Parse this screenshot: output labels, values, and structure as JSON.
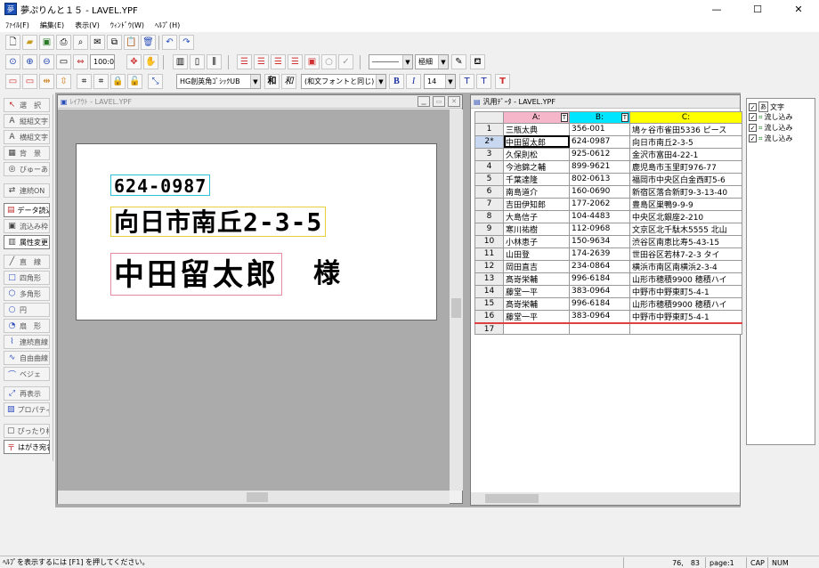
{
  "app": {
    "title": "夢ぷりんと１５ - LAVEL.YPF",
    "logo_glyph": "夢",
    "win_minimize": "—",
    "win_maximize": "☐",
    "win_close": "✕"
  },
  "menu": [
    "ﾌｧｲﾙ(F)",
    "編集(E)",
    "表示(V)",
    "ｳｨﾝﾄﾞｳ(W)",
    "ﾍﾙﾌﾟ(H)"
  ],
  "toolbar": {
    "zoom_value": "100:0",
    "line_style_value": "",
    "line_weight_value": "極細",
    "font_name_value": "HG創英角ｺﾞｼｯｸUB",
    "font_kanji_glyph": "和",
    "font_kanji_italic_glyph": "和",
    "western_font_value": "(和文フォントと同じ)",
    "bold_glyph": "B",
    "italic_glyph": "I",
    "font_size_value": "14"
  },
  "left_tools": [
    {
      "label": "選　択",
      "icon": "↖"
    },
    {
      "label": "縦組文字",
      "icon": "A"
    },
    {
      "label": "横組文字",
      "icon": "A"
    },
    {
      "label": "背　景",
      "icon": "▦"
    },
    {
      "label": "びゅーあ",
      "icon": "◎"
    },
    {
      "label": "連続ON",
      "icon": "⇄"
    },
    {
      "label": "データ読込",
      "icon": "▤"
    },
    {
      "label": "流込み枠",
      "icon": "▣"
    },
    {
      "label": "属性変更",
      "icon": "▥"
    },
    {
      "label": "直　線",
      "icon": "╱"
    },
    {
      "label": "四角形",
      "icon": "□"
    },
    {
      "label": "多角形",
      "icon": "⬡"
    },
    {
      "label": "円",
      "icon": "○"
    },
    {
      "label": "扇　形",
      "icon": "◔"
    },
    {
      "label": "連続直線",
      "icon": "⌇"
    },
    {
      "label": "自由曲線",
      "icon": "∿"
    },
    {
      "label": "ベジェ",
      "icon": "⌒"
    },
    {
      "label": "再表示",
      "icon": "⤢"
    },
    {
      "label": "プロパティ",
      "icon": "▧"
    },
    {
      "label": "ぴったり枠",
      "icon": "▢"
    },
    {
      "label": "はがき宛名",
      "icon": "〒"
    }
  ],
  "layout_window": {
    "title": "ﾚｲｱｳﾄ - LAVEL.YPF",
    "postal": "624-0987",
    "address": "向日市南丘2-3-5",
    "name": "中田留太郎",
    "honorific": "様"
  },
  "data_window": {
    "title": "汎用ﾃﾞｰﾀ - LAVEL.YPF",
    "columns": [
      "A:",
      "B:",
      "C:"
    ],
    "col_badges": [
      "T",
      "T"
    ],
    "rows": [
      {
        "n": "1",
        "a": "三瓶太典",
        "b": "356-001",
        "c": "鳩ヶ谷市雀田5336 ピース"
      },
      {
        "n": "2*",
        "a": "中田留太郎",
        "b": "624-0987",
        "c": "向日市南丘2-3-5"
      },
      {
        "n": "3",
        "a": "久保則松",
        "b": "925-0612",
        "c": "金沢市富田4-22-1"
      },
      {
        "n": "4",
        "a": "今池錦之輔",
        "b": "899-9621",
        "c": "鹿児島市玉里町976-77"
      },
      {
        "n": "5",
        "a": "千葉達隆",
        "b": "802-0613",
        "c": "福岡市中央区白金西町5-6"
      },
      {
        "n": "6",
        "a": "南島道介",
        "b": "160-0690",
        "c": "新宿区落合新町9-3-13-40"
      },
      {
        "n": "7",
        "a": "吉田伊知郎",
        "b": "177-2062",
        "c": "豊島区巣鴨9-9-9"
      },
      {
        "n": "8",
        "a": "大島信子",
        "b": "104-4483",
        "c": "中央区北銀座2-210"
      },
      {
        "n": "9",
        "a": "寒川祐樹",
        "b": "112-0968",
        "c": "文京区北千駄木5555 北山"
      },
      {
        "n": "10",
        "a": "小林恵子",
        "b": "150-9634",
        "c": "渋谷区南恵比寿5-43-15 "
      },
      {
        "n": "11",
        "a": "山田登",
        "b": "174-2639",
        "c": "世田谷区若林7-2-3 タイ"
      },
      {
        "n": "12",
        "a": "岡田直吉",
        "b": "234-0864",
        "c": "横浜市南区南横浜2-3-4"
      },
      {
        "n": "13",
        "a": "髙嵜栄輔",
        "b": "996-6184",
        "c": "山形市穂積9900 穂積ハイ"
      },
      {
        "n": "14",
        "a": "藤堂一平",
        "b": "383-0964",
        "c": "中野市中野東町5-4-1"
      },
      {
        "n": "15",
        "a": "髙嵜栄輔",
        "b": "996-6184",
        "c": "山形市穂積9900 穂積ハイ"
      },
      {
        "n": "16",
        "a": "藤堂一平",
        "b": "383-0964",
        "c": "中野市中野東町5-4-1"
      },
      {
        "n": "17",
        "a": "",
        "b": "",
        "c": ""
      }
    ]
  },
  "object_tree": [
    {
      "label": "文字",
      "glyph": "あ"
    },
    {
      "label": "流し込み",
      "glyph": "⌗"
    },
    {
      "label": "流し込み",
      "glyph": "⌗"
    },
    {
      "label": "流し込み",
      "glyph": "⌗"
    }
  ],
  "status": {
    "help": "ﾍﾙﾌﾟを表示するには [F1] を押してください。",
    "coords": "76,　83",
    "page": "page:1",
    "cap": "CAP",
    "num": "NUM"
  },
  "colors": {
    "col_a_header": "#f4b6c8",
    "col_b_header": "#00e5ff",
    "col_c_header": "#ffff00",
    "postal_box": "#29c4d6",
    "address_box": "#e8d03a",
    "name_box": "#e68aa0"
  }
}
